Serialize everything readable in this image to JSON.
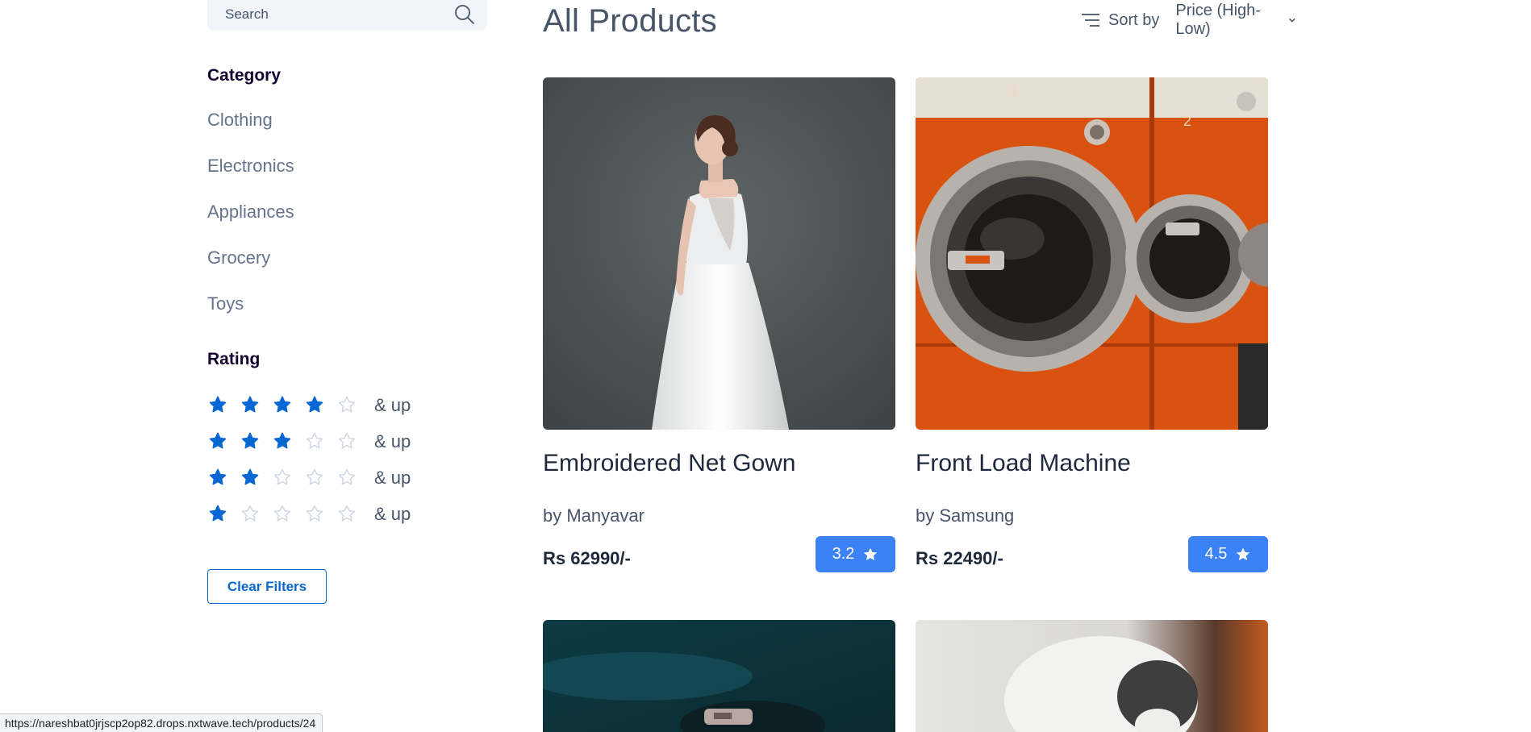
{
  "search": {
    "placeholder": "Search"
  },
  "filters": {
    "category_heading": "Category",
    "categories": [
      {
        "label": "Clothing"
      },
      {
        "label": "Electronics"
      },
      {
        "label": "Appliances"
      },
      {
        "label": "Grocery"
      },
      {
        "label": "Toys"
      }
    ],
    "rating_heading": "Rating",
    "ratings": [
      {
        "filled": 4,
        "label": "& up"
      },
      {
        "filled": 3,
        "label": "& up"
      },
      {
        "filled": 2,
        "label": "& up"
      },
      {
        "filled": 1,
        "label": "& up"
      }
    ],
    "clear_label": "Clear Filters"
  },
  "main": {
    "title": "All Products",
    "sort_label": "Sort by",
    "sort_selected": "Price (High-Low)"
  },
  "products": [
    {
      "title": "Embroidered Net Gown",
      "brand": "by Manyavar",
      "price": "Rs 62990/-",
      "rating": "3.2",
      "image": "bridal-gown-photo"
    },
    {
      "title": "Front Load Machine",
      "brand": "by Samsung",
      "price": "Rs 22490/-",
      "rating": "4.5",
      "image": "washing-machines-photo"
    },
    {
      "image": "dark-teal-product-photo"
    },
    {
      "image": "white-object-photo"
    }
  ],
  "status_bar": {
    "url": "https://nareshbat0jrjscp2op82.drops.nxtwave.tech/products/24"
  },
  "colors": {
    "accent": "#0967d2",
    "badge": "#3b82f6",
    "star_empty": "#cbd5e1"
  }
}
